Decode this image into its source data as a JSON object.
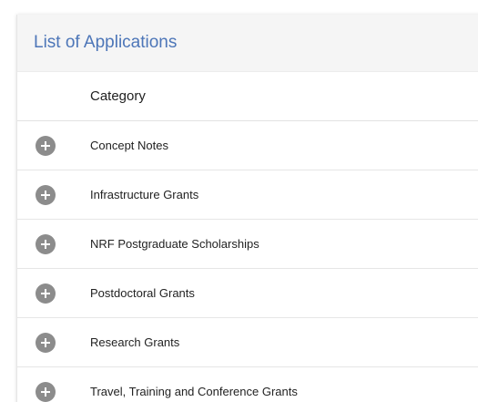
{
  "panel": {
    "title": "List of Applications"
  },
  "table": {
    "column_header": "Category",
    "rows": [
      {
        "label": "Concept Notes",
        "icon": "plus-circle-icon"
      },
      {
        "label": "Infrastructure Grants",
        "icon": "plus-circle-icon"
      },
      {
        "label": "NRF Postgraduate Scholarships",
        "icon": "plus-circle-icon"
      },
      {
        "label": "Postdoctoral Grants",
        "icon": "plus-circle-icon"
      },
      {
        "label": "Research Grants",
        "icon": "plus-circle-icon"
      },
      {
        "label": "Travel, Training and Conference Grants",
        "icon": "plus-circle-icon"
      }
    ]
  },
  "colors": {
    "title": "#4d76b8",
    "expand_icon": "#8c8c8c",
    "header_bg": "#f5f5f5"
  }
}
